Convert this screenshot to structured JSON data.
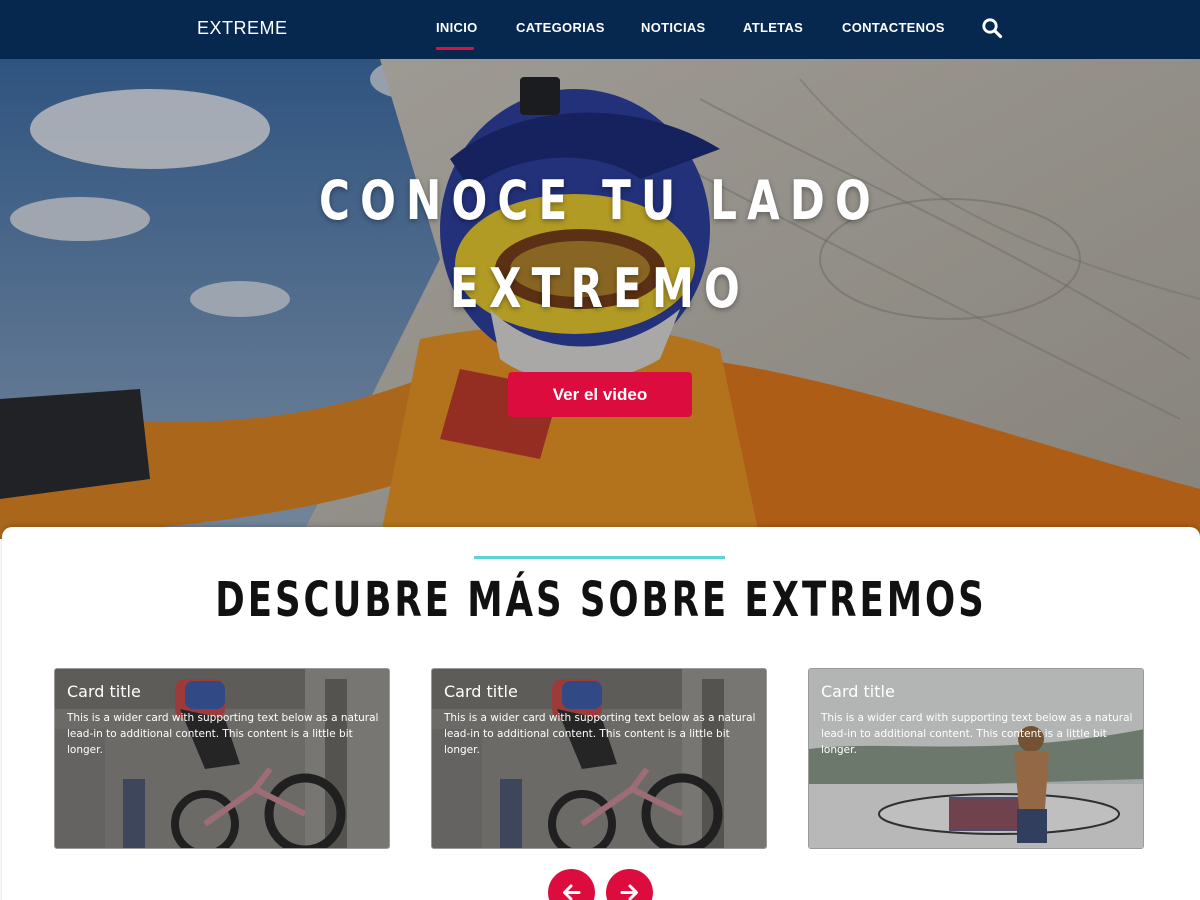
{
  "nav": {
    "brand": "EXTREME",
    "items": [
      {
        "label": "INICIO",
        "active": true
      },
      {
        "label": "CATEGORIAS",
        "active": false
      },
      {
        "label": "NOTICIAS",
        "active": false
      },
      {
        "label": "ATLETAS",
        "active": false
      },
      {
        "label": "CONTACTENOS",
        "active": false
      }
    ],
    "search_icon": "search-icon"
  },
  "hero": {
    "title_line1": "CONOCE TU LADO",
    "title_line2": "EXTREMO",
    "button_label": "Ver el video"
  },
  "section": {
    "title": "DESCUBRE MÁS SOBRE EXTREMOS",
    "cards": [
      {
        "title": "Card title",
        "text": "This is a wider card with supporting text below as a natural lead-in to additional content. This content is a little bit longer.",
        "image": "bmx-rider"
      },
      {
        "title": "Card title",
        "text": "This is a wider card with supporting text below as a natural lead-in to additional content. This content is a little bit longer.",
        "image": "bmx-rider"
      },
      {
        "title": "Card title",
        "text": "This is a wider card with supporting text below as a natural lead-in to additional content. This content is a little bit longer.",
        "image": "surfer"
      }
    ],
    "prev_icon": "arrow-left-icon",
    "next_icon": "arrow-right-icon"
  },
  "colors": {
    "navbar": "#06284f",
    "accent": "#dc0d3e",
    "section_rule": "#5ed3d7"
  }
}
